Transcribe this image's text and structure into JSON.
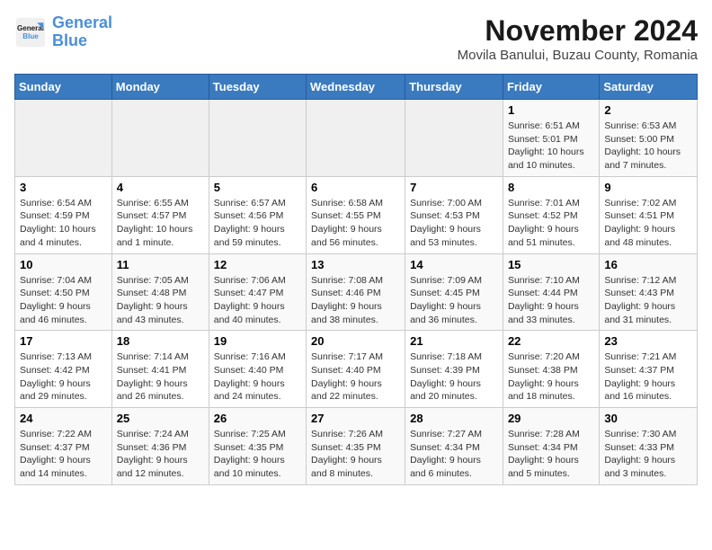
{
  "logo": {
    "line1": "General",
    "line2": "Blue"
  },
  "title": "November 2024",
  "subtitle": "Movila Banului, Buzau County, Romania",
  "days_of_week": [
    "Sunday",
    "Monday",
    "Tuesday",
    "Wednesday",
    "Thursday",
    "Friday",
    "Saturday"
  ],
  "weeks": [
    [
      {
        "day": "",
        "info": ""
      },
      {
        "day": "",
        "info": ""
      },
      {
        "day": "",
        "info": ""
      },
      {
        "day": "",
        "info": ""
      },
      {
        "day": "",
        "info": ""
      },
      {
        "day": "1",
        "info": "Sunrise: 6:51 AM\nSunset: 5:01 PM\nDaylight: 10 hours and 10 minutes."
      },
      {
        "day": "2",
        "info": "Sunrise: 6:53 AM\nSunset: 5:00 PM\nDaylight: 10 hours and 7 minutes."
      }
    ],
    [
      {
        "day": "3",
        "info": "Sunrise: 6:54 AM\nSunset: 4:59 PM\nDaylight: 10 hours and 4 minutes."
      },
      {
        "day": "4",
        "info": "Sunrise: 6:55 AM\nSunset: 4:57 PM\nDaylight: 10 hours and 1 minute."
      },
      {
        "day": "5",
        "info": "Sunrise: 6:57 AM\nSunset: 4:56 PM\nDaylight: 9 hours and 59 minutes."
      },
      {
        "day": "6",
        "info": "Sunrise: 6:58 AM\nSunset: 4:55 PM\nDaylight: 9 hours and 56 minutes."
      },
      {
        "day": "7",
        "info": "Sunrise: 7:00 AM\nSunset: 4:53 PM\nDaylight: 9 hours and 53 minutes."
      },
      {
        "day": "8",
        "info": "Sunrise: 7:01 AM\nSunset: 4:52 PM\nDaylight: 9 hours and 51 minutes."
      },
      {
        "day": "9",
        "info": "Sunrise: 7:02 AM\nSunset: 4:51 PM\nDaylight: 9 hours and 48 minutes."
      }
    ],
    [
      {
        "day": "10",
        "info": "Sunrise: 7:04 AM\nSunset: 4:50 PM\nDaylight: 9 hours and 46 minutes."
      },
      {
        "day": "11",
        "info": "Sunrise: 7:05 AM\nSunset: 4:48 PM\nDaylight: 9 hours and 43 minutes."
      },
      {
        "day": "12",
        "info": "Sunrise: 7:06 AM\nSunset: 4:47 PM\nDaylight: 9 hours and 40 minutes."
      },
      {
        "day": "13",
        "info": "Sunrise: 7:08 AM\nSunset: 4:46 PM\nDaylight: 9 hours and 38 minutes."
      },
      {
        "day": "14",
        "info": "Sunrise: 7:09 AM\nSunset: 4:45 PM\nDaylight: 9 hours and 36 minutes."
      },
      {
        "day": "15",
        "info": "Sunrise: 7:10 AM\nSunset: 4:44 PM\nDaylight: 9 hours and 33 minutes."
      },
      {
        "day": "16",
        "info": "Sunrise: 7:12 AM\nSunset: 4:43 PM\nDaylight: 9 hours and 31 minutes."
      }
    ],
    [
      {
        "day": "17",
        "info": "Sunrise: 7:13 AM\nSunset: 4:42 PM\nDaylight: 9 hours and 29 minutes."
      },
      {
        "day": "18",
        "info": "Sunrise: 7:14 AM\nSunset: 4:41 PM\nDaylight: 9 hours and 26 minutes."
      },
      {
        "day": "19",
        "info": "Sunrise: 7:16 AM\nSunset: 4:40 PM\nDaylight: 9 hours and 24 minutes."
      },
      {
        "day": "20",
        "info": "Sunrise: 7:17 AM\nSunset: 4:40 PM\nDaylight: 9 hours and 22 minutes."
      },
      {
        "day": "21",
        "info": "Sunrise: 7:18 AM\nSunset: 4:39 PM\nDaylight: 9 hours and 20 minutes."
      },
      {
        "day": "22",
        "info": "Sunrise: 7:20 AM\nSunset: 4:38 PM\nDaylight: 9 hours and 18 minutes."
      },
      {
        "day": "23",
        "info": "Sunrise: 7:21 AM\nSunset: 4:37 PM\nDaylight: 9 hours and 16 minutes."
      }
    ],
    [
      {
        "day": "24",
        "info": "Sunrise: 7:22 AM\nSunset: 4:37 PM\nDaylight: 9 hours and 14 minutes."
      },
      {
        "day": "25",
        "info": "Sunrise: 7:24 AM\nSunset: 4:36 PM\nDaylight: 9 hours and 12 minutes."
      },
      {
        "day": "26",
        "info": "Sunrise: 7:25 AM\nSunset: 4:35 PM\nDaylight: 9 hours and 10 minutes."
      },
      {
        "day": "27",
        "info": "Sunrise: 7:26 AM\nSunset: 4:35 PM\nDaylight: 9 hours and 8 minutes."
      },
      {
        "day": "28",
        "info": "Sunrise: 7:27 AM\nSunset: 4:34 PM\nDaylight: 9 hours and 6 minutes."
      },
      {
        "day": "29",
        "info": "Sunrise: 7:28 AM\nSunset: 4:34 PM\nDaylight: 9 hours and 5 minutes."
      },
      {
        "day": "30",
        "info": "Sunrise: 7:30 AM\nSunset: 4:33 PM\nDaylight: 9 hours and 3 minutes."
      }
    ]
  ]
}
